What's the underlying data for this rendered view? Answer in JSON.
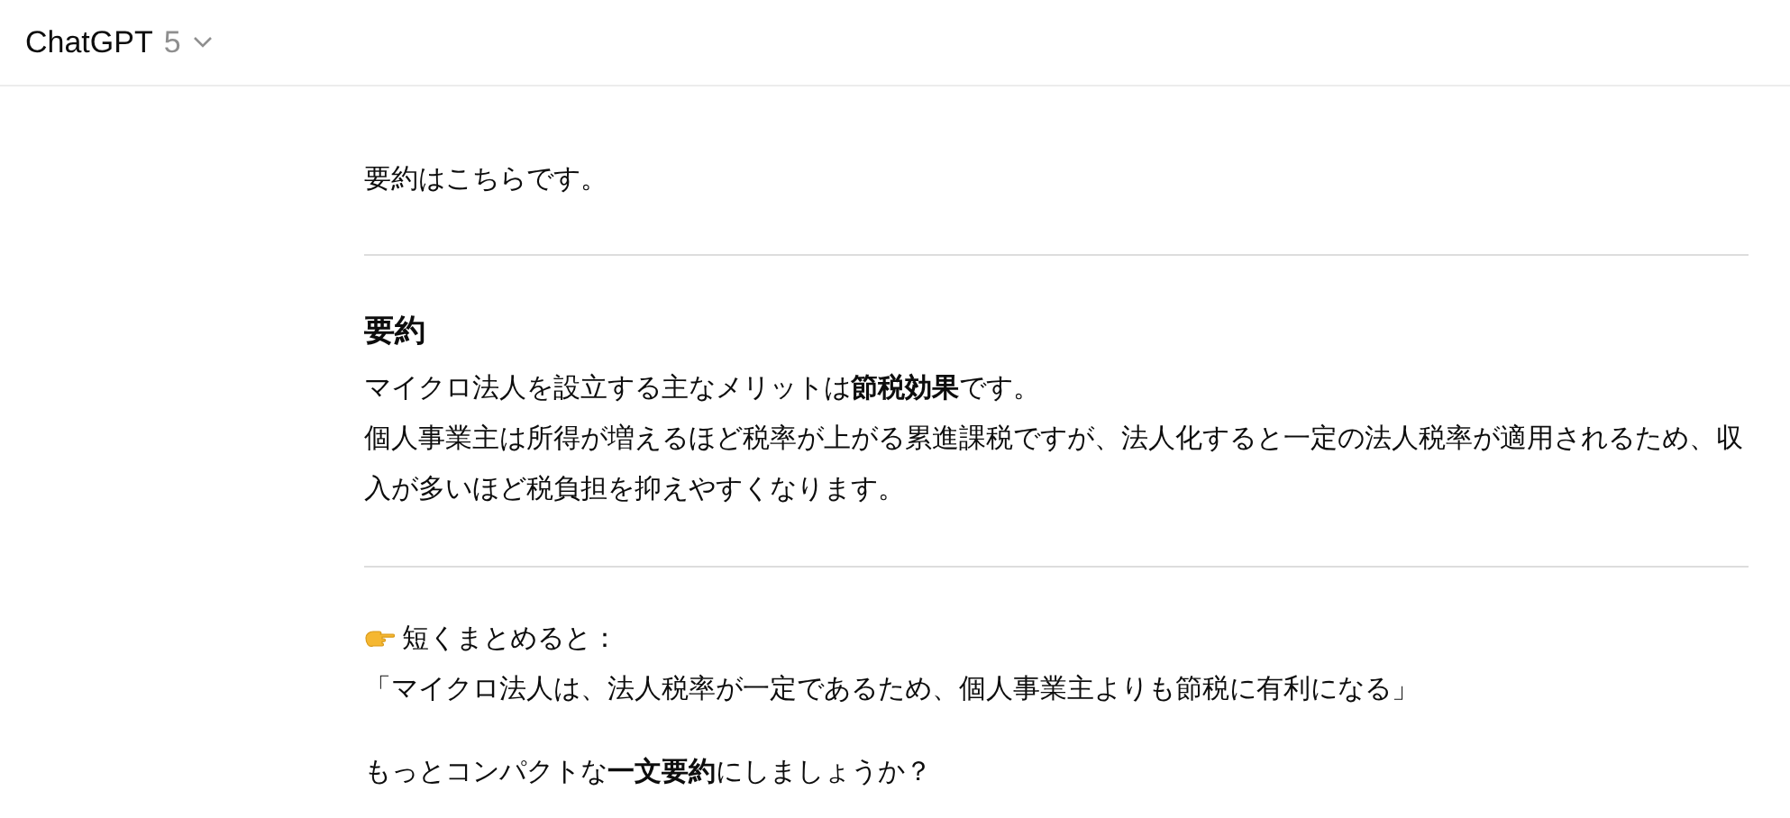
{
  "header": {
    "model_name": "ChatGPT",
    "model_version": "5"
  },
  "message": {
    "intro": "要約はこちらです。",
    "heading": "要約",
    "summary_lines": [
      "マイクロ法人を設立する主なメリットは**節税効果**です。",
      "個人事業主は所得が増えるほど税率が上がる累進課税ですが、法人化すると一定の法人税率が適用されるため、収入が多いほど税負担を抑えやすくなります。"
    ],
    "short_label": "短くまとめると：",
    "short_quote": "「マイクロ法人は、法人税率が一定であるため、個人事業主よりも節税に有利になる」",
    "question": "もっとコンパクトな**一文要約**にしましょうか？"
  }
}
